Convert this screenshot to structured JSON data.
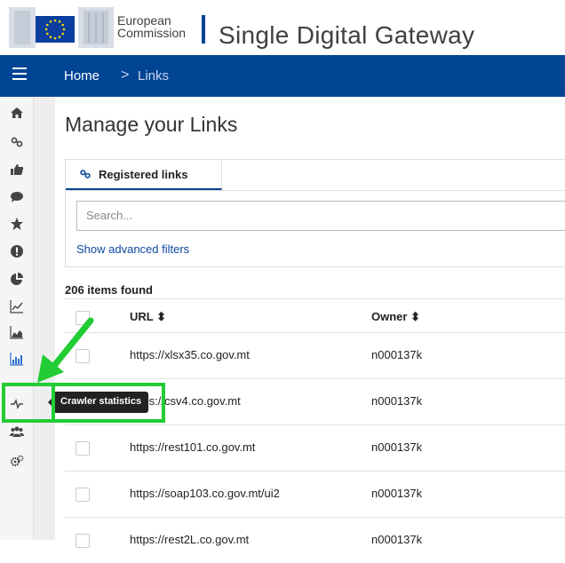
{
  "header": {
    "ec_line1": "European",
    "ec_line2": "Commission",
    "app_title": "Single Digital Gateway"
  },
  "nav": {
    "breadcrumb_home": "Home",
    "breadcrumb_sep": ">",
    "breadcrumb_current": "Links"
  },
  "sidebar": {
    "items": [
      {
        "icon": "home-icon"
      },
      {
        "icon": "link-icon"
      },
      {
        "icon": "thumbs-up-icon"
      },
      {
        "icon": "comment-icon"
      },
      {
        "icon": "star-icon"
      },
      {
        "icon": "alert-icon"
      },
      {
        "icon": "pie-chart-icon"
      },
      {
        "icon": "line-chart-icon"
      },
      {
        "icon": "area-chart-icon"
      },
      {
        "icon": "bar-chart-icon"
      },
      {
        "icon": "heartbeat-icon"
      },
      {
        "icon": "users-icon"
      },
      {
        "icon": "cogs-icon"
      }
    ]
  },
  "main": {
    "title": "Manage your Links",
    "tab_label": "Registered links",
    "search_placeholder": "Search...",
    "advanced_filters": "Show advanced filters",
    "items_found": "206 items found",
    "columns": {
      "url": "URL",
      "owner": "Owner"
    },
    "rows": [
      {
        "url": "https://xlsx35.co.gov.mt",
        "owner": "n000137k"
      },
      {
        "url": "https://csv4.co.gov.mt",
        "owner": "n000137k"
      },
      {
        "url": "https://rest101.co.gov.mt",
        "owner": "n000137k"
      },
      {
        "url": "https://soap103.co.gov.mt/ui2",
        "owner": "n000137k"
      },
      {
        "url": "https://rest2L.co.gov.mt",
        "owner": "n000137k"
      }
    ]
  },
  "tooltip": {
    "text": "Crawler statistics"
  },
  "colors": {
    "brand": "#004494",
    "highlight": "#22cc33"
  }
}
